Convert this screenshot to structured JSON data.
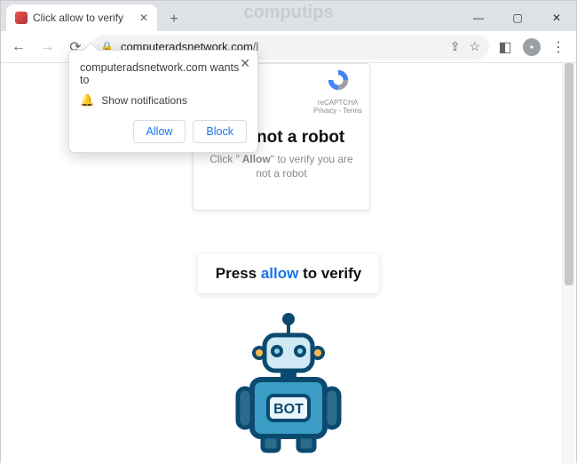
{
  "watermark": "computips",
  "tab": {
    "title": "Click allow to verify"
  },
  "window": {
    "min": "—",
    "max": "▢",
    "close": "✕"
  },
  "toolbar": {
    "url_host": "computeradsnetwork.com",
    "url_path": "/l"
  },
  "perm": {
    "domain_line": "computeradsnetwork.com wants to",
    "request": "Show notifications",
    "allow": "Allow",
    "block": "Block"
  },
  "robot": {
    "title": "I am not a robot",
    "sub_prefix": "Click \"",
    "sub_allow": " Allow",
    "sub_suffix": "\" to verify you are not a robot",
    "recaptcha_label": "reCAPTCHA",
    "recaptcha_small": "Privacy - Terms"
  },
  "press": {
    "pre": "Press ",
    "allow": "allow",
    "post": " to verify"
  },
  "bot_label": "BOT"
}
